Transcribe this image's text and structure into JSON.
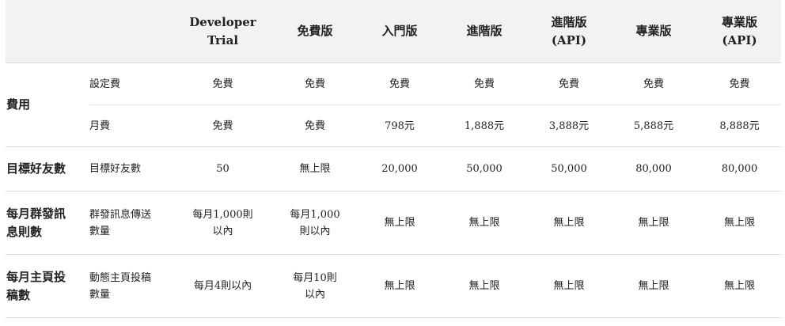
{
  "header": {
    "empty1": "",
    "empty2": "",
    "plans": [
      "Developer\nTrial",
      "免費版",
      "入門版",
      "進階版",
      "進階版\n(API)",
      "專業版",
      "專業版\n(API)"
    ]
  },
  "rows": {
    "fee": {
      "category": "費用",
      "setup": {
        "label": "設定費",
        "values": [
          "免費",
          "免費",
          "免費",
          "免費",
          "免費",
          "免費",
          "免費"
        ]
      },
      "monthly": {
        "label": "月費",
        "values": [
          "免費",
          "免費",
          "798元",
          "1,888元",
          "3,888元",
          "5,888元",
          "8,888元"
        ]
      }
    },
    "friends": {
      "category": "目標好友數",
      "label": "目標好友數",
      "values": [
        "50",
        "無上限",
        "20,000",
        "50,000",
        "50,000",
        "80,000",
        "80,000"
      ]
    },
    "broadcast": {
      "category": "每月群發訊\n息則數",
      "label": "群發訊息傳送\n數量",
      "values": [
        "每月1,000則\n以內",
        "每月1,000\n則以內",
        "無上限",
        "無上限",
        "無上限",
        "無上限",
        "無上限"
      ]
    },
    "posts": {
      "category": "每月主頁投\n稿數",
      "label": "動態主頁投稿\n數量",
      "values": [
        "每月4則以內",
        "每月10則\n以內",
        "無上限",
        "無上限",
        "無上限",
        "無上限",
        "無上限"
      ]
    }
  }
}
